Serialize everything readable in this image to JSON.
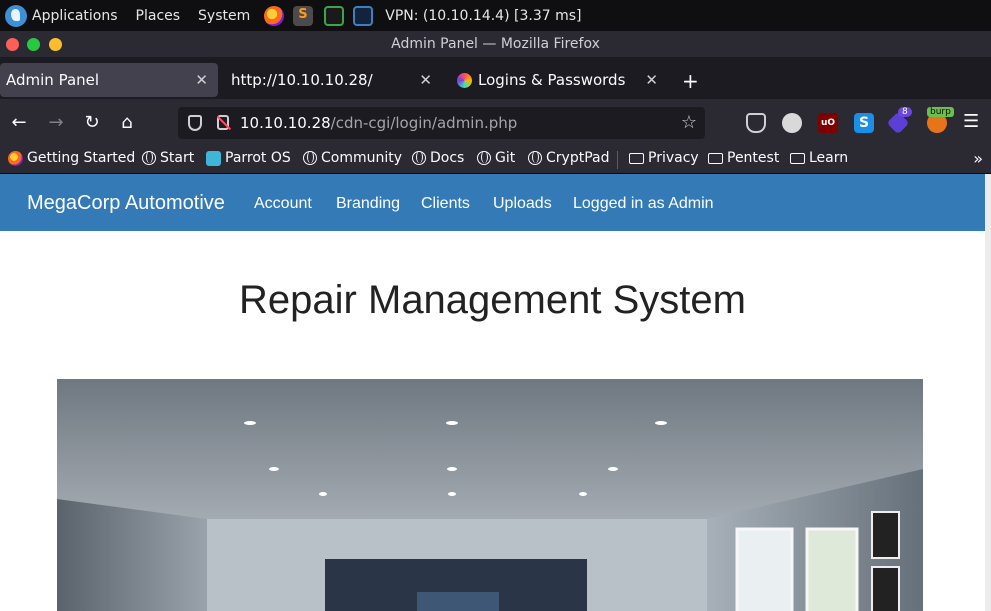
{
  "os_panel": {
    "applications": "Applications",
    "places": "Places",
    "system": "System",
    "vpn": "VPN: (10.10.14.4) [3.37 ms]"
  },
  "window": {
    "title": "Admin Panel — Mozilla Firefox"
  },
  "tabs": [
    {
      "label": "Admin Panel",
      "active": true
    },
    {
      "label": "http://10.10.10.28/",
      "active": false
    },
    {
      "label": "Logins & Passwords",
      "active": false
    }
  ],
  "url": {
    "host": "10.10.10.28",
    "path": "/cdn-cgi/login/admin.php"
  },
  "extensions": {
    "ubo_label": "uO",
    "badge_count": "8",
    "burp_label": "burp",
    "s_label": "S"
  },
  "bookmarks": [
    {
      "label": "Getting Started",
      "icon": "firefox-icon"
    },
    {
      "label": "Start",
      "icon": "globe-icon"
    },
    {
      "label": "Parrot OS",
      "icon": "parrot-icon"
    },
    {
      "label": "Community",
      "icon": "globe-icon"
    },
    {
      "label": "Docs",
      "icon": "globe-icon"
    },
    {
      "label": "Git",
      "icon": "globe-icon"
    },
    {
      "label": "CryptPad",
      "icon": "globe-icon"
    },
    {
      "label": "Privacy",
      "icon": "folder-icon"
    },
    {
      "label": "Pentest",
      "icon": "folder-icon"
    },
    {
      "label": "Learn",
      "icon": "folder-icon"
    }
  ],
  "site": {
    "brand": "MegaCorp Automotive",
    "nav": [
      "Account",
      "Branding",
      "Clients",
      "Uploads",
      "Logged in as Admin"
    ],
    "heading": "Repair Management System",
    "nav_color": "#337ab7"
  }
}
